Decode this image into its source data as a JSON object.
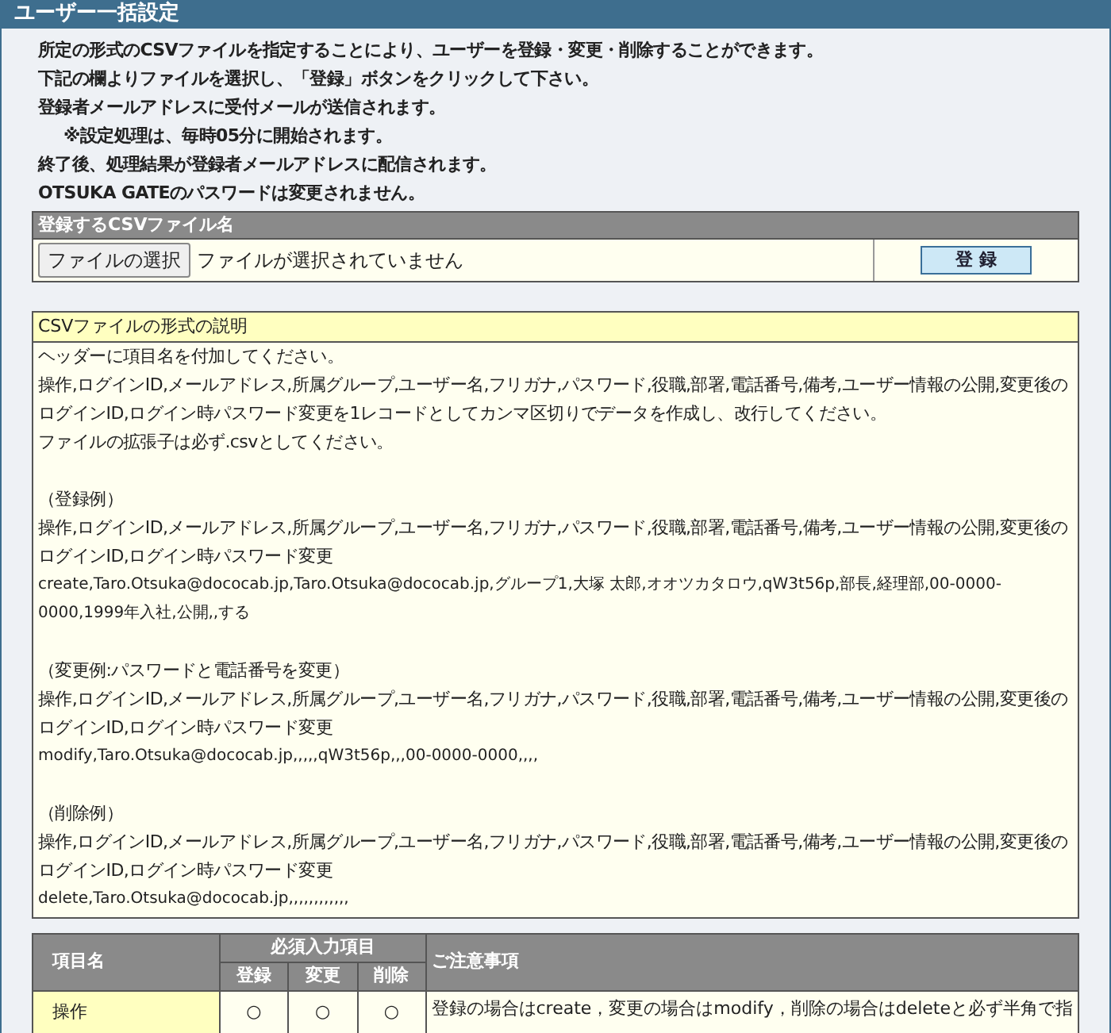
{
  "window": {
    "title": "ユーザー一括設定"
  },
  "intro": [
    "所定の形式のCSVファイルを指定することにより、ユーザーを登録・変更・削除することができます。",
    "下記の欄よりファイルを選択し、「登録」ボタンをクリックして下さい。",
    "登録者メールアドレスに受付メールが送信されます。",
    "※設定処理は、毎時05分に開始されます。",
    "終了後、処理結果が登録者メールアドレスに配信されます。",
    "OTSUKA GATEのパスワードは変更されません。"
  ],
  "upload": {
    "title": "登録するCSVファイル名",
    "file_button": "ファイルの選択",
    "file_status": "ファイルが選択されていません",
    "submit": "登 録"
  },
  "description": {
    "title": "CSVファイルの形式の説明",
    "blocks": [
      {
        "lines": [
          {
            "kind": "text",
            "text": "ヘッダーに項目名を付加してください。"
          },
          {
            "kind": "text",
            "text": "操作,ログインID,メールアドレス,所属グループ,ユーザー名,フリガナ,パスワード,役職,部署,電話番号,備考,ユーザー情報の公開,変更後のログインID,ログイン時パスワード変更を1レコードとしてカンマ区切りでデータを作成し、改行してください。"
          },
          {
            "kind": "text",
            "text": "ファイルの拡張子は必ず.csvとしてください。"
          }
        ]
      },
      {
        "lines": [
          {
            "kind": "text",
            "text": "（登録例）"
          },
          {
            "kind": "text",
            "text": "操作,ログインID,メールアドレス,所属グループ,ユーザー名,フリガナ,パスワード,役職,部署,電話番号,備考,ユーザー情報の公開,変更後のログインID,ログイン時パスワード変更"
          },
          {
            "kind": "sample",
            "text": "create,Taro.Otsuka@dococab.jp,Taro.Otsuka@dococab.jp,グループ1,大塚 太郎,オオツカタロウ,qW3t56p,部長,経理部,00-0000-0000,1999年入社,公開,,する"
          }
        ]
      },
      {
        "lines": [
          {
            "kind": "text",
            "text": "（変更例:パスワードと電話番号を変更）"
          },
          {
            "kind": "text",
            "text": "操作,ログインID,メールアドレス,所属グループ,ユーザー名,フリガナ,パスワード,役職,部署,電話番号,備考,ユーザー情報の公開,変更後のログインID,ログイン時パスワード変更"
          },
          {
            "kind": "sample",
            "text": "modify,Taro.Otsuka@dococab.jp,,,,,qW3t56p,,,00-0000-0000,,,,"
          }
        ]
      },
      {
        "lines": [
          {
            "kind": "text",
            "text": "（削除例）"
          },
          {
            "kind": "text",
            "text": "操作,ログインID,メールアドレス,所属グループ,ユーザー名,フリガナ,パスワード,役職,部署,電話番号,備考,ユーザー情報の公開,変更後のログインID,ログイン時パスワード変更"
          },
          {
            "kind": "sample",
            "text": "delete,Taro.Otsuka@dococab.jp,,,,,,,,,,,,"
          }
        ]
      }
    ]
  },
  "table": {
    "columns": {
      "name": "項目名",
      "required": "必須入力項目",
      "register": "登録",
      "change": "変更",
      "delete": "削除",
      "notes": "ご注意事項"
    },
    "rows": [
      {
        "name": "操作",
        "register": "○",
        "change": "○",
        "delete": "○",
        "notes": "登録の場合はcreate，変更の場合はmodify，削除の場合はdeleteと必ず半角で指"
      }
    ]
  }
}
